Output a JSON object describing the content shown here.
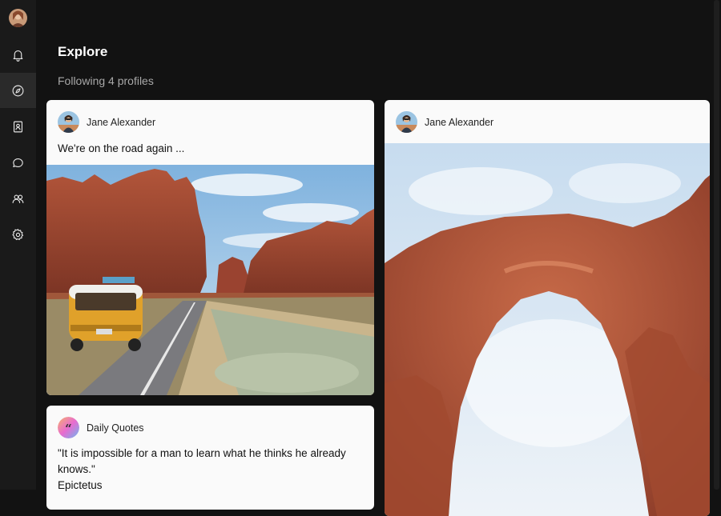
{
  "sidebar": {
    "items": [
      {
        "name": "notifications",
        "icon": "bell-icon"
      },
      {
        "name": "explore",
        "icon": "compass-icon",
        "active": true
      },
      {
        "name": "profiles",
        "icon": "bookmark-book-icon"
      },
      {
        "name": "messages",
        "icon": "chat-bubble-icon"
      },
      {
        "name": "people",
        "icon": "users-icon"
      },
      {
        "name": "settings",
        "icon": "gear-icon"
      }
    ]
  },
  "header": {
    "title": "Explore",
    "subtitle": "Following 4 profiles"
  },
  "posts": [
    {
      "author": "Jane Alexander",
      "text": "We're on the road again ...",
      "image": "desert-road-van-photo"
    },
    {
      "author": "Daily Quotes",
      "text": "\"It is impossible for a man to learn what he thinks he already knows.\"",
      "attribution": "Epictetus"
    },
    {
      "author": "Jane Alexander",
      "text": "",
      "image": "rock-arch-photo"
    }
  ],
  "colors": {
    "background": "#121212",
    "sidebar": "#1a1a1a",
    "card": "#fafafa",
    "subtitle": "#a8a8a8"
  }
}
